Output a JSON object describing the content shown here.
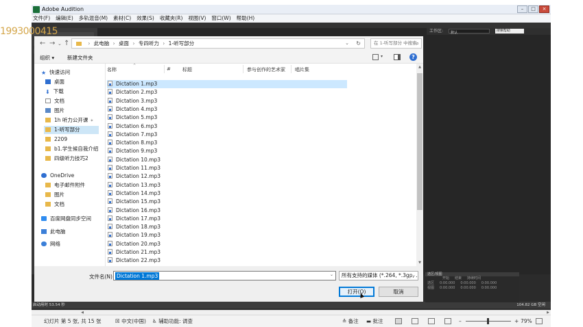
{
  "watermark": "1993000415",
  "audition": {
    "title": "Adobe Audition",
    "menu": [
      "文件(F)",
      "编辑(E)",
      "多轨混音(M)",
      "素材(C)",
      "效果(S)",
      "收藏夹(R)",
      "视图(V)",
      "窗口(W)",
      "帮助(H)"
    ],
    "workspace_label": "工作区:",
    "workspace_value": "默认",
    "search_placeholder": "搜索帮助",
    "selection_panel": {
      "title": "选区/视图",
      "columns": [
        "开始",
        "结束",
        "持续时间"
      ],
      "rows": [
        {
          "label": "选区",
          "values": [
            "0:00.000",
            "0:00.000",
            "0:00.000"
          ]
        },
        {
          "label": "视图",
          "values": [
            "0:00.000",
            "0:00.000",
            "0:00.000"
          ]
        }
      ]
    },
    "status_left": "启动用时 53.54 秒",
    "status_right": "104.82 GB 空闲"
  },
  "dialog": {
    "breadcrumb": [
      "此电脑",
      "桌面",
      "专四听力",
      "1-听写部分"
    ],
    "search_placeholder": "在 1-听写部分 中搜索",
    "organize_label": "组织 ▾",
    "new_folder_label": "新建文件夹",
    "nav": {
      "quick_access": "快速访问",
      "items": [
        {
          "label": "桌面",
          "pinned": true
        },
        {
          "label": "下载",
          "pinned": true
        },
        {
          "label": "文档",
          "pinned": true
        },
        {
          "label": "图片",
          "pinned": true
        },
        {
          "label": "1h 听力公开课",
          "pinned": true
        },
        {
          "label": "1-听写部分",
          "pinned": false
        },
        {
          "label": "2209",
          "pinned": false
        },
        {
          "label": "b1.学生候自我介绍",
          "pinned": false
        },
        {
          "label": "四级听力技巧2",
          "pinned": false
        }
      ],
      "onedrive": "OneDrive",
      "onedrive_items": [
        "电子邮件附件",
        "图片",
        "文档"
      ],
      "baidu": "百度网盘同步空间",
      "this_pc": "此电脑",
      "network": "网络"
    },
    "columns": {
      "name": "名称",
      "number": "#",
      "title": "标题",
      "artist": "参与创作的艺术家",
      "album": "唱片集"
    },
    "files": [
      "Dictation 1.mp3",
      "Dictation 2.mp3",
      "Dictation 3.mp3",
      "Dictation 4.mp3",
      "Dictation 5.mp3",
      "Dictation 6.mp3",
      "Dictation 7.mp3",
      "Dictation 8.mp3",
      "Dictation 9.mp3",
      "Dictation 10.mp3",
      "Dictation 11.mp3",
      "Dictation 12.mp3",
      "Dictation 13.mp3",
      "Dictation 14.mp3",
      "Dictation 15.mp3",
      "Dictation 16.mp3",
      "Dictation 17.mp3",
      "Dictation 18.mp3",
      "Dictation 19.mp3",
      "Dictation 20.mp3",
      "Dictation 21.mp3",
      "Dictation 22.mp3"
    ],
    "selected_file_index": 0,
    "filename_label": "文件名(N):",
    "filename_value": "Dictation 1.mp3",
    "filetype_value": "所有支持的媒体 (*.264, *.3gp, ...",
    "open_button": "打开(O)",
    "cancel_button": "取消"
  },
  "host_status": {
    "slide_info": "幻灯片 第 5 张, 共 15 张",
    "language": "中文(中国)",
    "accessibility": "辅助功能: 调查",
    "notes": "备注",
    "comments": "批注",
    "zoom": "79%"
  }
}
